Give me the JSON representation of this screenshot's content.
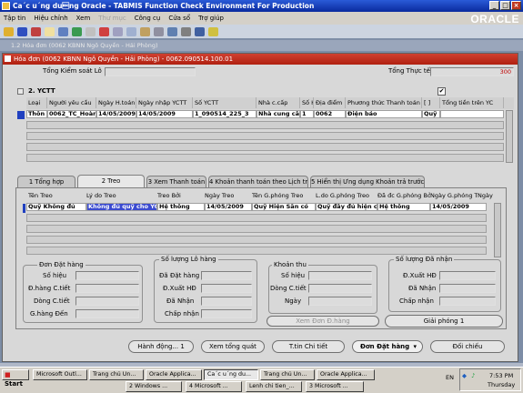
{
  "window": {
    "title": "Ca´c u´ng du\u001bng Oracle - TABMIS Function Check Environment For Production"
  },
  "menu": [
    "Tập tin",
    "Hiệu chỉnh",
    "Xem",
    "Thư mục",
    "Công cụ",
    "Cửa sổ",
    "Trợ giúp"
  ],
  "oracle_logo": "ORACLE",
  "bg_window": {
    "title": "1.2 Hóa đơn (0062 KBNN Ngô Quyền - Hải Phòng)"
  },
  "form": {
    "title": "Hóa đơn (0062 KBNN Ngô Quyền - Hải Phòng) - 0062.090514.100.01",
    "tong_kiem_soat_label": "Tổng Kiểm soát Lô",
    "tong_thuc_te_label": "Tổng Thực tế",
    "tong_thuc_te_value": "300",
    "section_title": "2. YCTT",
    "checkbox_mark": "✔",
    "grid": {
      "headers": [
        "Loại",
        "Người yêu cầu",
        "Ngày H.toán",
        "Ngày nhập YCTT",
        "Số YCTT",
        "Nhà c.cấp",
        "Số H",
        "Địa điểm",
        "Phương thức Thanh toán",
        "[ ]",
        "Tổng tiền trên YC"
      ],
      "row": [
        "Thôn",
        "0062_TC_Hoàng",
        "14/05/2009",
        "14/05/2009",
        "1_090514_225_3",
        "Nhà cung cấ",
        "1",
        "0062",
        "Điện báo",
        "Quỹ l",
        ""
      ]
    },
    "tabs": [
      "1 Tổng hợp",
      "2 Treo",
      "3 Xem Thanh toán",
      "4 Khoản thanh toán theo Lịch trình",
      "5 Hiển thị Ưng dụng Khoản trả trước"
    ],
    "active_tab": 1,
    "treo": {
      "headers": [
        "Tên Treo",
        "Lý do Treo",
        "Treo Bởi",
        "Ngày Treo",
        "Tên G.phóng Treo",
        "L.do G.phóng Treo",
        "Đã đc G.phóng Bởi",
        "Ngày G.phóng Treo",
        "Ngày"
      ],
      "row": [
        "Quỹ Không đủ",
        "Không đủ quỹ cho YC",
        "Hệ thống",
        "14/05/2009",
        "Quỹ Hiện Sẵn có",
        "Quỹ đầy đủ hiện có",
        "Hệ thống",
        "14/05/2009"
      ]
    },
    "groups": {
      "don_dat_hang": {
        "title": "Đơn Đặt hàng",
        "labels": [
          "Số hiệu",
          "Đ.hàng C.tiết",
          "Dòng C.tiết",
          "G.hàng Đến"
        ]
      },
      "so_luong_lo_hang": {
        "title": "Số lượng Lô hàng",
        "labels": [
          "Đã Đặt hàng",
          "Đ.Xuất HĐ",
          "Đã Nhận",
          "Chấp nhận"
        ]
      },
      "khoan_thu": {
        "title": "Khoản thu",
        "labels": [
          "Số hiệu",
          "Dòng C.tiết",
          "Ngày"
        ]
      },
      "so_luong_da_nhan": {
        "title": "Số lượng Đã nhận",
        "labels": [
          "Đ.Xuất HĐ",
          "Đã Nhận",
          "Chấp nhận"
        ]
      }
    },
    "buttons": {
      "xem_don_dat_hang": "Xem Đơn Đ.hàng",
      "giai_phong": "Giải phóng 1",
      "hanh_dong": "Hành động... 1",
      "xem_tong_quat": "Xem tổng quát",
      "t_tin_chi_tiet": "T.tin Chi tiết",
      "don_dat_hang_select": "Đơn Đặt hàng",
      "doi_chieu": "Đối chiếu"
    }
  },
  "taskbar": {
    "start": "Start",
    "items_row1": [
      "Microsoft Outl...",
      "Trang chủ Un...",
      "Oracle Applica...",
      "Ca´c u´ng du...",
      "Trang chủ Un...",
      "Oracle Applica..."
    ],
    "items_row2": [
      "2 Windows ...",
      "4 Microsoft ...",
      "Lenh chi tien_...",
      "3 Microsoft ..."
    ],
    "tray_lang": "EN",
    "clock": "7:53 PM",
    "day": "Thursday"
  }
}
